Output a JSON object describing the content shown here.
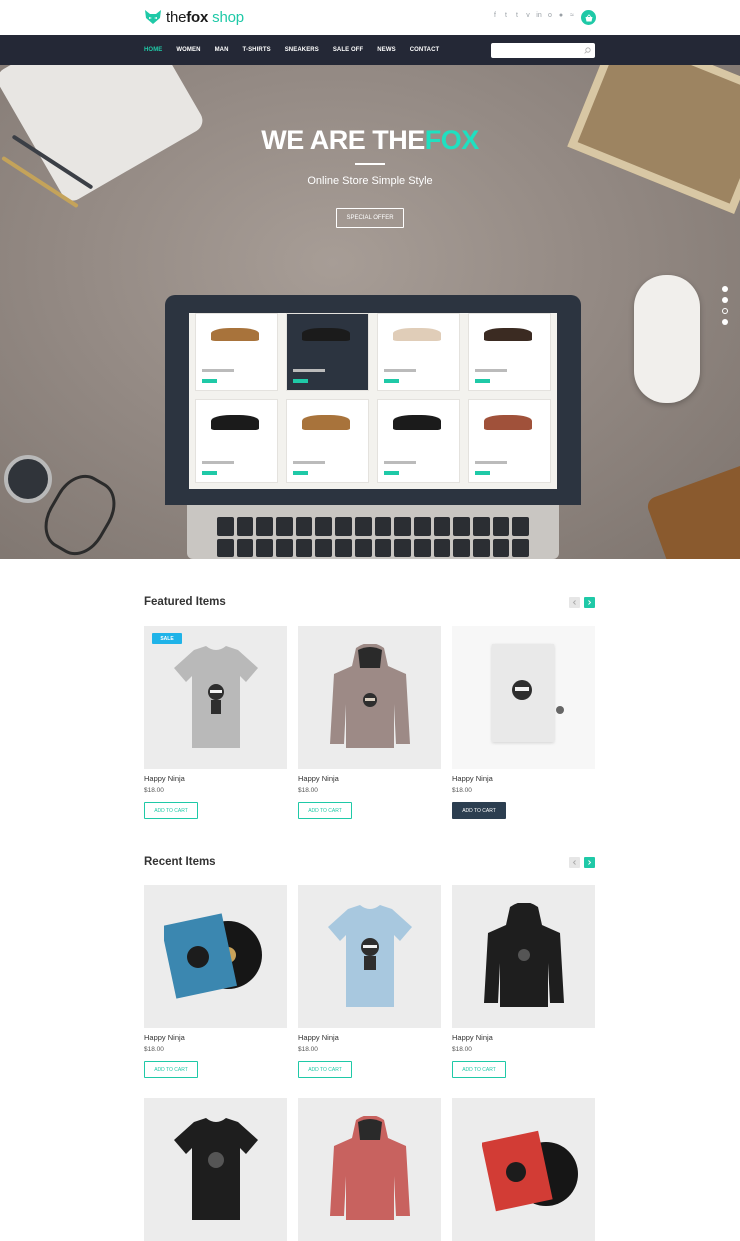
{
  "brand": {
    "name_prefix": "the",
    "name_bold": "fox",
    "name_suffix": " shop",
    "accent": "#1fc9a7"
  },
  "social_icons": [
    "facebook-icon",
    "twitter-icon",
    "tumblr-icon",
    "vimeo-icon",
    "linkedin-icon",
    "instagram-icon",
    "flickr-icon",
    "rss-icon"
  ],
  "social_glyphs": [
    "f",
    "t",
    "t",
    "v",
    "in",
    "o",
    "●",
    "≈"
  ],
  "nav": {
    "items": [
      {
        "label": "HOME",
        "active": true
      },
      {
        "label": "WOMEN"
      },
      {
        "label": "MAN"
      },
      {
        "label": "T-SHIRTS"
      },
      {
        "label": "SNEAKERS"
      },
      {
        "label": "SALE OFF"
      },
      {
        "label": "NEWS"
      },
      {
        "label": "CONTACT"
      }
    ],
    "search_placeholder": ""
  },
  "hero": {
    "title_main": "WE ARE THE",
    "title_accent": "FOX",
    "subtitle": "Online Store Simple Style",
    "button": "SPECIAL OFFER",
    "slides": 4,
    "active_slide": 3
  },
  "featured": {
    "title": "Featured Items",
    "items": [
      {
        "name": "Happy Ninja",
        "price": "$18.00",
        "button": "ADD TO CART",
        "badge": "SALE"
      },
      {
        "name": "Happy Ninja",
        "price": "$18.00",
        "button": "ADD TO CART"
      },
      {
        "name": "Happy Ninja",
        "price": "$18.00",
        "button": "ADD TO CART",
        "hover": true
      }
    ]
  },
  "recent": {
    "title": "Recent Items",
    "items": [
      {
        "name": "Happy Ninja",
        "price": "$18.00",
        "button": "ADD TO CART"
      },
      {
        "name": "Happy Ninja",
        "price": "$18.00",
        "button": "ADD TO CART"
      },
      {
        "name": "Happy Ninja",
        "price": "$18.00",
        "button": "ADD TO CART"
      }
    ]
  }
}
